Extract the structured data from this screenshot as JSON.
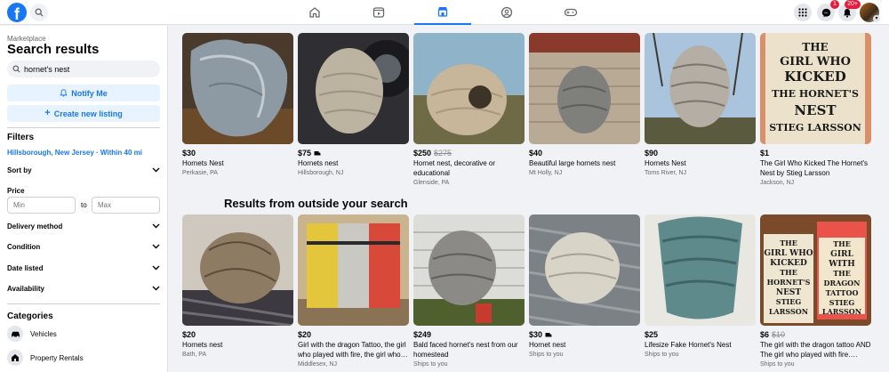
{
  "header": {
    "logo": "f",
    "badges": {
      "messenger": "1",
      "notifications": "20+"
    },
    "icons": [
      "facebook-logo",
      "search-icon",
      "home-icon",
      "video-icon",
      "marketplace-icon",
      "groups-icon",
      "gaming-icon",
      "menu-grid-icon",
      "messenger-icon",
      "bell-icon"
    ]
  },
  "sidebar": {
    "crumb": "Marketplace",
    "title": "Search results",
    "search_value": "hornet's nest",
    "notify_label": "Notify Me",
    "create_label": "Create new listing",
    "filters_heading": "Filters",
    "location": "Hillsborough, New Jersey · Within 40 mi",
    "sort_by": "Sort by",
    "price_label": "Price",
    "price_min_placeholder": "Min",
    "price_to": "to",
    "price_max_placeholder": "Max",
    "delivery": "Delivery method",
    "condition": "Condition",
    "date_listed": "Date listed",
    "availability": "Availability",
    "categories_heading": "Categories",
    "categories": [
      {
        "label": "Vehicles",
        "icon": "car-icon"
      },
      {
        "label": "Property Rentals",
        "icon": "house-icon"
      }
    ]
  },
  "main": {
    "outside_heading": "Results from outside your search",
    "row1": [
      {
        "price": "$30",
        "old_price": "",
        "title": "Hornets Nest",
        "location": "Perkasie, PA",
        "shipping": false
      },
      {
        "price": "$75",
        "old_price": "",
        "title": "Hornets nest",
        "location": "Hillsborough, NJ",
        "shipping": true
      },
      {
        "price": "$250",
        "old_price": "$275",
        "title": "Hornet nest, decorative or educational",
        "location": "Glenside, PA",
        "shipping": false
      },
      {
        "price": "$40",
        "old_price": "",
        "title": "Beautiful large hornets nest",
        "location": "Mt Holly, NJ",
        "shipping": false
      },
      {
        "price": "$90",
        "old_price": "",
        "title": "Hornets Nest",
        "location": "Toms River, NJ",
        "shipping": false
      },
      {
        "price": "$1",
        "old_price": "",
        "title": "The Girl Who Kicked The Hornet's Nest by Stieg Larsson",
        "location": "Jackson, NJ",
        "shipping": false
      }
    ],
    "row2": [
      {
        "price": "$20",
        "old_price": "",
        "title": "Hornets nest",
        "location": "Bath, PA",
        "shipping": false
      },
      {
        "price": "$20",
        "old_price": "",
        "title": "Girl with the dragon Tattoo, the girl who played with fire, the girl who…",
        "location": "Middlesex, NJ",
        "shipping": false
      },
      {
        "price": "$249",
        "old_price": "",
        "title": "Bald faced hornet's nest from our homestead",
        "location": "Ships to you",
        "shipping": false
      },
      {
        "price": "$30",
        "old_price": "",
        "title": "Hornet nest",
        "location": "Ships to you",
        "shipping": true
      },
      {
        "price": "$25",
        "old_price": "",
        "title": "Lifesize Fake Hornet's Nest",
        "location": "Ships to you",
        "shipping": false
      },
      {
        "price": "$6",
        "old_price": "$10",
        "title": "The girl with the dragon tattoo AND The girl who played with fire….",
        "location": "Ships to you",
        "shipping": false
      }
    ],
    "book_cover": {
      "lines": [
        "THE",
        "GIRL WHO",
        "KICKED",
        "THE HORNET'S",
        "NEST",
        "STIEG LARSSON"
      ]
    },
    "book_stack_covers": [
      {
        "lines": [
          "THE",
          "GIRL WHO",
          "KICKED",
          "THE",
          "HORNET'S",
          "NEST",
          "STIEG",
          "LARSSON"
        ]
      },
      {
        "lines": [
          "THE",
          "GIRL",
          "WITH",
          "THE",
          "DRAGON",
          "TATTOO",
          "STIEG",
          "LARSSON"
        ]
      }
    ],
    "colors": {
      "accent": "#1877f2",
      "badge": "#e41e3f"
    }
  }
}
